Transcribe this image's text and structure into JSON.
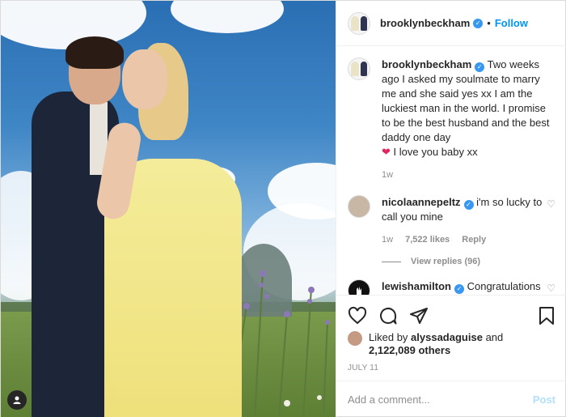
{
  "header": {
    "username": "brooklynbeckham",
    "dot": "•",
    "follow_label": "Follow"
  },
  "caption": {
    "username": "brooklynbeckham",
    "text": "Two weeks ago I asked my soulmate to marry me and she said yes xx I am the luckiest man in the world. I promise to be the best husband and the best daddy one day",
    "heart": "❤",
    "text_after": "I love you baby xx",
    "time": "1w"
  },
  "comments": [
    {
      "username": "nicolaannepeltz",
      "text": "i'm so lucky to call you mine",
      "time": "1w",
      "likes": "7,522 likes",
      "reply_label": "Reply",
      "view_replies": "View replies (96)"
    },
    {
      "username": "lewishamilton",
      "text": "Congratulations bro"
    }
  ],
  "likes": {
    "prefix": "Liked by",
    "user": "alyssadaguise",
    "and": "and",
    "others": "2,122,089 others"
  },
  "date": "JULY 11",
  "add_comment": {
    "placeholder": "Add a comment...",
    "post_label": "Post"
  },
  "icons": {
    "like": "heart-icon",
    "comment": "comment-icon",
    "share": "share-icon",
    "save": "bookmark-icon"
  }
}
